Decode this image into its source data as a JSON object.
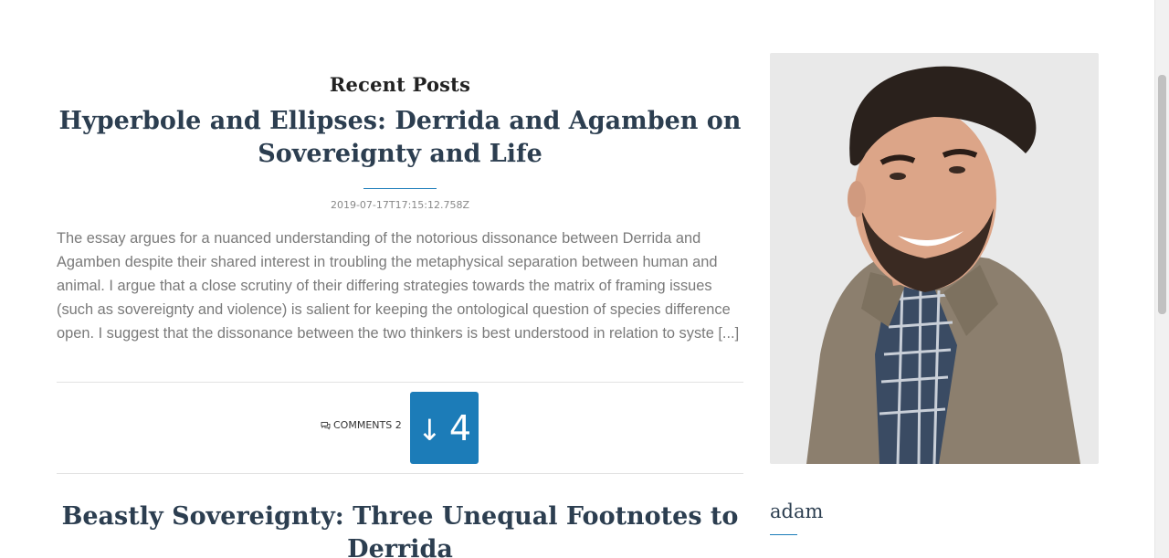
{
  "main": {
    "section_title": "Recent Posts",
    "posts": [
      {
        "title": "Hyperbole and Ellipses: Derrida and Agamben on Sovereignty and Life",
        "date": "2019-07-17T17:15:12.758Z",
        "excerpt": "The essay argues for a nuanced understanding of the notorious dissonance between Derrida and Agamben despite their shared interest in troubling the metaphysical separation between human and animal. I argue that a close scrutiny of their differing strategies towards the matrix of framing issues (such as sovereignty and violence) is salient for keeping the ontological question of species difference open. I suggest that the dissonance between the two thinkers is best understood in relation to syste [...]",
        "comments_label": "COMMENTS 2",
        "vote_arrow": "↓",
        "vote_count": "4"
      },
      {
        "title": "Beastly Sovereignty: Three Unequal Footnotes to Derrida"
      }
    ]
  },
  "sidebar": {
    "author_name": "adam"
  },
  "icons": {
    "comments": "comments-icon",
    "vote": "downvote-arrow-icon"
  },
  "colors": {
    "accent": "#1c7cb8",
    "title": "#2c3e50",
    "excerpt": "#7a7a7a"
  }
}
